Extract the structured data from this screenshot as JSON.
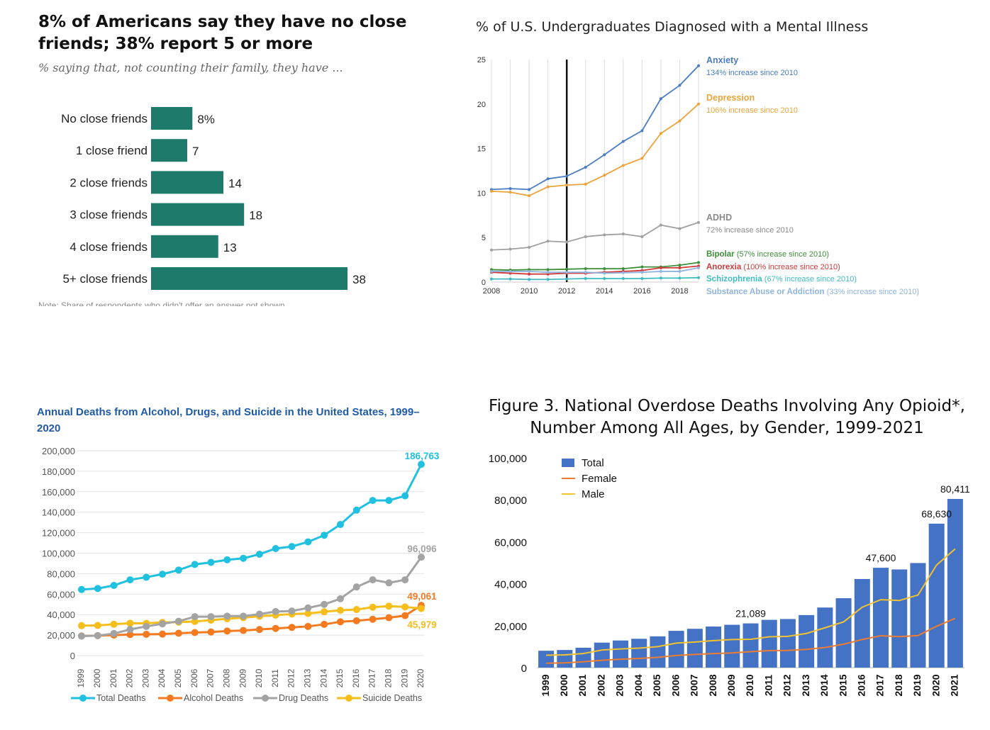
{
  "chart_data": [
    {
      "type": "bar",
      "orientation": "horizontal",
      "title": "8% of Americans say they have no close friends; 38% report 5 or more",
      "subtitle": "% saying that, not counting their family, they have ...",
      "footnote": "Note: Share of respondents who didn't offer an answer not shown.",
      "categories": [
        "No close friends",
        "1 close friend",
        "2 close friends",
        "3 close friends",
        "4 close friends",
        "5+ close friends"
      ],
      "values": [
        8,
        7,
        14,
        18,
        13,
        38
      ],
      "value_labels": [
        "8%",
        "7",
        "14",
        "18",
        "13",
        "38"
      ],
      "color": "#1e7a6a"
    },
    {
      "type": "line",
      "title": "% of U.S. Undergraduates Diagnosed with a Mental Illness",
      "x": [
        2008,
        2009,
        2010,
        2011,
        2012,
        2013,
        2014,
        2015,
        2016,
        2017,
        2018,
        2019
      ],
      "xticks": [
        "2008",
        "2010",
        "2012",
        "2014",
        "2016",
        "2018"
      ],
      "yticks": [
        "0",
        "5",
        "10",
        "15",
        "20",
        "25"
      ],
      "ylim": [
        0,
        25
      ],
      "marker_year": 2012,
      "series": [
        {
          "name": "Anxiety",
          "note": "134% increase since 2010",
          "color": "#4a7cc4",
          "values": [
            10.4,
            10.5,
            10.4,
            11.6,
            11.9,
            12.9,
            14.3,
            15.8,
            17.0,
            20.6,
            22.1,
            24.3
          ]
        },
        {
          "name": "Depression",
          "note": "106% increase since 2010",
          "color": "#eba33a",
          "values": [
            10.2,
            10.1,
            9.7,
            10.7,
            10.9,
            11.0,
            12.0,
            13.1,
            13.9,
            16.7,
            18.1,
            20.0
          ]
        },
        {
          "name": "ADHD",
          "note": "72% increase since 2010",
          "color": "#a0a0a0",
          "values": [
            3.6,
            3.7,
            3.9,
            4.6,
            4.5,
            5.1,
            5.3,
            5.4,
            5.1,
            6.4,
            6.0,
            6.7
          ]
        },
        {
          "name": "Bipolar",
          "note": "(57% increase since 2010)",
          "color": "#3f8f3a",
          "values": [
            1.4,
            1.35,
            1.4,
            1.4,
            1.45,
            1.5,
            1.5,
            1.5,
            1.7,
            1.7,
            1.9,
            2.2
          ]
        },
        {
          "name": "Anorexia",
          "note": "(100% increase since 2010)",
          "color": "#d03a3a",
          "values": [
            1.1,
            1.0,
            0.9,
            0.9,
            1.0,
            1.0,
            1.1,
            1.2,
            1.3,
            1.6,
            1.6,
            1.8
          ]
        },
        {
          "name": "Schizophrenia",
          "note": "(67% increase since 2010)",
          "color": "#3dbcc0",
          "values": [
            0.35,
            0.35,
            0.3,
            0.3,
            0.35,
            0.4,
            0.4,
            0.4,
            0.4,
            0.45,
            0.45,
            0.5
          ]
        },
        {
          "name": "Substance Abuse or Addiction",
          "note": "(33% increase since 2010)",
          "color": "#8fb4e0",
          "values": [
            1.2,
            1.2,
            1.2,
            1.1,
            1.1,
            1.1,
            1.0,
            1.05,
            1.1,
            1.2,
            1.2,
            1.6
          ]
        }
      ]
    },
    {
      "type": "line",
      "title": "Annual Deaths from Alcohol, Drugs, and Suicide in the United States, 1999–2020",
      "x": [
        "1999",
        "2000",
        "2001",
        "2002",
        "2003",
        "2004",
        "2005",
        "2006",
        "2007",
        "2008",
        "2009",
        "2010",
        "2011",
        "2012",
        "2013",
        "2014",
        "2015",
        "2016",
        "2017",
        "2018",
        "2019",
        "2020"
      ],
      "yticks": [
        "0",
        "20,000",
        "40,000",
        "60,000",
        "80,000",
        "100,000",
        "120,000",
        "140,000",
        "160,000",
        "180,000",
        "200,000"
      ],
      "ylim": [
        0,
        200000
      ],
      "grid": true,
      "legend": "bottom",
      "series": [
        {
          "name": "Total Deaths",
          "color": "#1fc0e0",
          "end_label": "186,763",
          "values": [
            64500,
            65500,
            68500,
            74000,
            76500,
            79500,
            83500,
            89000,
            91000,
            93500,
            95000,
            99000,
            104500,
            106500,
            111000,
            117500,
            128000,
            142000,
            151500,
            151500,
            156000,
            186763
          ]
        },
        {
          "name": "Alcohol Deaths",
          "color": "#f47a1f",
          "end_label": "49,061",
          "values": [
            19200,
            19500,
            20000,
            20500,
            20800,
            21000,
            21800,
            22500,
            23000,
            24000,
            24500,
            25500,
            26500,
            27500,
            28500,
            30500,
            33000,
            34000,
            35500,
            37000,
            39000,
            49061
          ]
        },
        {
          "name": "Drug Deaths",
          "color": "#a3a3a3",
          "end_label": "96,096",
          "values": [
            19000,
            19500,
            21500,
            25500,
            28500,
            31000,
            33500,
            38000,
            38000,
            38500,
            38500,
            40500,
            43000,
            43500,
            46500,
            50000,
            55500,
            67000,
            74000,
            71000,
            74000,
            96096
          ]
        },
        {
          "name": "Suicide Deaths",
          "color": "#f6be1a",
          "end_label": "45,979",
          "values": [
            29200,
            29400,
            30600,
            31600,
            31500,
            32400,
            32600,
            33300,
            34600,
            36000,
            37000,
            38400,
            39500,
            40600,
            41100,
            42800,
            44200,
            45000,
            47200,
            48300,
            47500,
            45979
          ]
        }
      ]
    },
    {
      "type": "bar",
      "title": "Figure 3. National Overdose Deaths Involving Any Opioid*, Number Among All Ages, by Gender, 1999-2021",
      "categories": [
        "1999",
        "2000",
        "2001",
        "2002",
        "2003",
        "2004",
        "2005",
        "2006",
        "2007",
        "2008",
        "2009",
        "2010",
        "2011",
        "2012",
        "2013",
        "2014",
        "2015",
        "2016",
        "2017",
        "2018",
        "2019",
        "2020",
        "2021"
      ],
      "yticks": [
        "0",
        "20,000",
        "40,000",
        "60,000",
        "80,000",
        "100,000"
      ],
      "ylim": [
        0,
        100000
      ],
      "legend": "top-left",
      "series": [
        {
          "name": "Total",
          "type": "bar",
          "color": "#4472c4",
          "values": [
            8050,
            8407,
            9496,
            11920,
            12940,
            13756,
            14918,
            17545,
            18516,
            19582,
            20422,
            21089,
            22784,
            23166,
            25052,
            28647,
            33091,
            42249,
            47600,
            46802,
            49860,
            68630,
            80411
          ]
        },
        {
          "name": "Female",
          "type": "line",
          "color": "#ed7d31",
          "values": [
            2100,
            2300,
            2800,
            3500,
            4000,
            4400,
            4900,
            5800,
            6300,
            6700,
            7000,
            7600,
            8100,
            8200,
            8700,
            9600,
            11200,
            13400,
            15200,
            14800,
            15300,
            19700,
            23500
          ]
        },
        {
          "name": "Male",
          "type": "line",
          "color": "#f2c230",
          "values": [
            5900,
            6100,
            6700,
            8400,
            8900,
            9300,
            10000,
            11700,
            12200,
            12900,
            13400,
            13500,
            14700,
            14900,
            16300,
            19000,
            21800,
            28800,
            32400,
            32000,
            34600,
            48900,
            56600
          ]
        }
      ],
      "data_labels": [
        {
          "index": 11,
          "text": "21,089"
        },
        {
          "index": 18,
          "text": "47,600"
        },
        {
          "index": 21,
          "text": "68,630"
        },
        {
          "index": 22,
          "text": "80,411"
        }
      ]
    }
  ]
}
